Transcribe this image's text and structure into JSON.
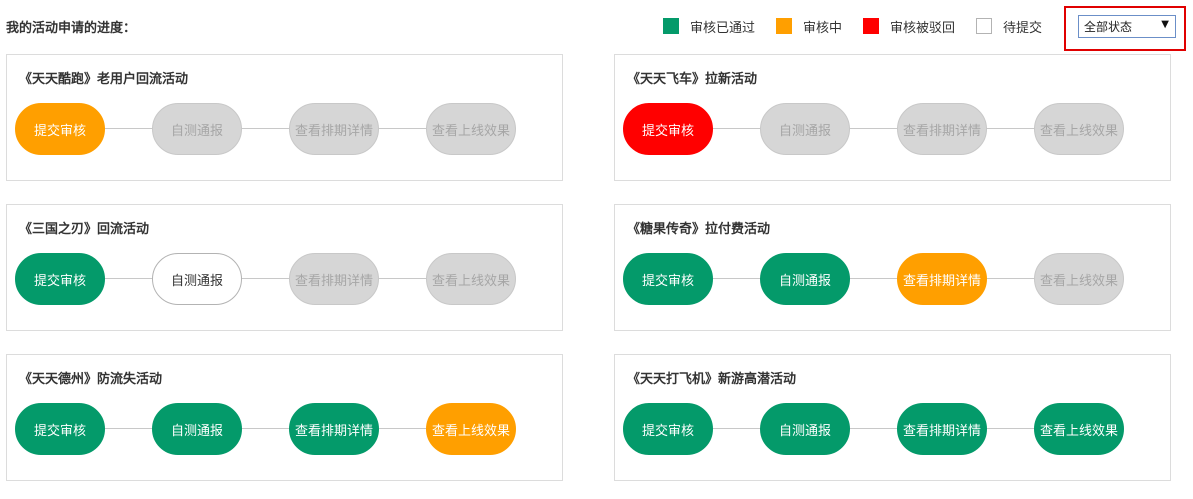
{
  "header": {
    "title": "我的活动申请的进度："
  },
  "legend": [
    {
      "label": "审核已通过",
      "state": "approved",
      "color": "#049a6a"
    },
    {
      "label": "审核中",
      "state": "reviewing",
      "color": "#ff9f00"
    },
    {
      "label": "审核被驳回",
      "state": "rejected",
      "color": "#ff0000"
    },
    {
      "label": "待提交",
      "state": "pending",
      "color": "#ffffff"
    }
  ],
  "status_filter": {
    "selected": "全部状态",
    "icon": "triangle-down"
  },
  "activities": [
    {
      "title": "《天天酷跑》老用户回流活动",
      "steps": [
        {
          "label": "提交审核",
          "state": "reviewing"
        },
        {
          "label": "自测通报",
          "state": "locked"
        },
        {
          "label": "查看排期详情",
          "state": "locked"
        },
        {
          "label": "查看上线效果",
          "state": "locked"
        }
      ]
    },
    {
      "title": "《天天飞车》拉新活动",
      "steps": [
        {
          "label": "提交审核",
          "state": "rejected"
        },
        {
          "label": "自测通报",
          "state": "locked"
        },
        {
          "label": "查看排期详情",
          "state": "locked"
        },
        {
          "label": "查看上线效果",
          "state": "locked"
        }
      ]
    },
    {
      "title": "《三国之刃》回流活动",
      "steps": [
        {
          "label": "提交审核",
          "state": "approved"
        },
        {
          "label": "自测通报",
          "state": "pending"
        },
        {
          "label": "查看排期详情",
          "state": "locked"
        },
        {
          "label": "查看上线效果",
          "state": "locked"
        }
      ]
    },
    {
      "title": "《糖果传奇》拉付费活动",
      "steps": [
        {
          "label": "提交审核",
          "state": "approved"
        },
        {
          "label": "自测通报",
          "state": "approved"
        },
        {
          "label": "查看排期详情",
          "state": "reviewing"
        },
        {
          "label": "查看上线效果",
          "state": "locked"
        }
      ]
    },
    {
      "title": "《天天德州》防流失活动",
      "steps": [
        {
          "label": "提交审核",
          "state": "approved"
        },
        {
          "label": "自测通报",
          "state": "approved"
        },
        {
          "label": "查看排期详情",
          "state": "approved"
        },
        {
          "label": "查看上线效果",
          "state": "reviewing"
        }
      ]
    },
    {
      "title": "《天天打飞机》新游高潜活动",
      "steps": [
        {
          "label": "提交审核",
          "state": "approved"
        },
        {
          "label": "自测通报",
          "state": "approved"
        },
        {
          "label": "查看排期详情",
          "state": "approved"
        },
        {
          "label": "查看上线效果",
          "state": "approved"
        }
      ]
    }
  ]
}
